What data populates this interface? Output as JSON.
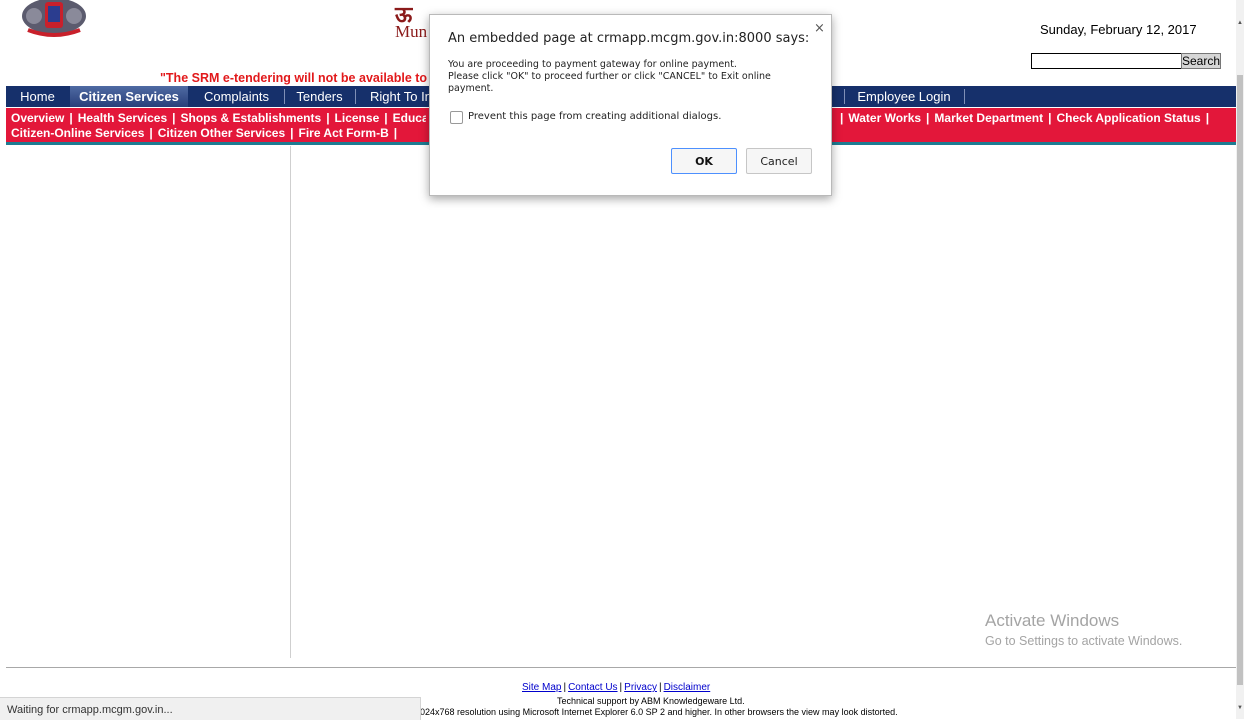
{
  "header": {
    "brand_line1": "ऊ",
    "brand_line2": "Mun",
    "date": "Sunday, February 12, 2017",
    "search_button": "Search",
    "notice": "\"The SRM e-tendering will not be available to MCGM"
  },
  "nav": {
    "items": [
      {
        "label": "Home"
      },
      {
        "label": "Citizen Services"
      },
      {
        "label": "Complaints"
      },
      {
        "label": "Tenders"
      },
      {
        "label": "Right To Information"
      },
      {
        "label": "Employee Login"
      }
    ]
  },
  "subnav": {
    "row1": [
      "Overview",
      "Health Services",
      "Shops & Establishments",
      "License",
      "Education"
    ],
    "row1_right": [
      "Water Works",
      "Market Department",
      "Check Application Status"
    ],
    "row2": [
      "Citizen-Online Services",
      "Citizen Other Services",
      "Fire Act Form-B"
    ],
    "separator": "|"
  },
  "dialog": {
    "title": "An embedded page at crmapp.mcgm.gov.in:8000 says:",
    "close": "×",
    "message_line1": "You are proceeding to payment gateway for online payment.",
    "message_line2": "Please click \"OK\" to proceed further or click \"CANCEL\" to Exit online",
    "message_line3": "payment.",
    "checkbox_label": "Prevent this page from creating additional dialogs.",
    "ok_label": "OK",
    "cancel_label": "Cancel"
  },
  "watermark": {
    "line1": "Activate Windows",
    "line2": "Go to Settings to activate Windows."
  },
  "footer": {
    "links": [
      "Site Map",
      "Contact Us",
      "Privacy",
      "Disclaimer"
    ],
    "support": "Technical support by ABM Knowledgeware Ltd.",
    "resolution": "024x768 resolution using Microsoft Internet Explorer 6.0 SP 2 and higher. In other browsers the view may look distorted."
  },
  "status_bar": {
    "text": "Waiting for crmapp.mcgm.gov.in..."
  },
  "colors": {
    "navbar": "#16306b",
    "subnav": "#e3173a",
    "notice": "#e2191b"
  }
}
